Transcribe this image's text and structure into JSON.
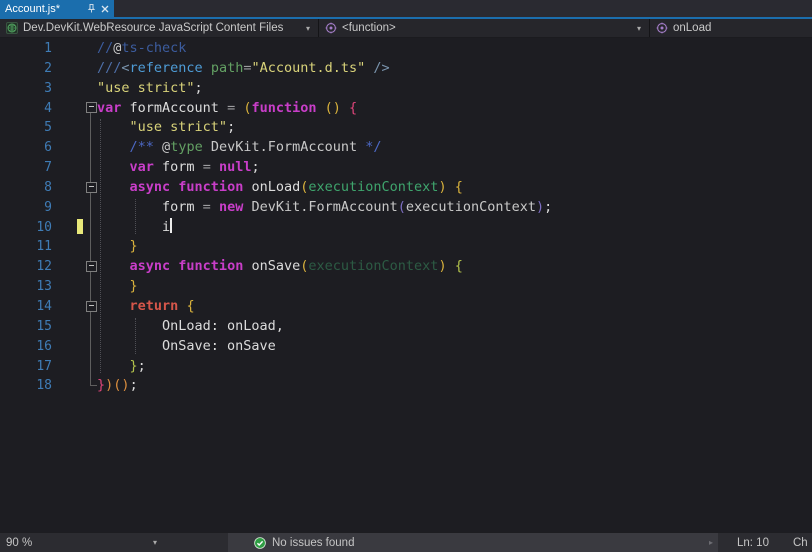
{
  "tab": {
    "title": "Account.js*",
    "pin_icon": "pin-icon",
    "close_icon": "close-icon"
  },
  "navbar": {
    "project": "Dev.DevKit.WebResource JavaScript Content Files",
    "scope": "<function>",
    "member": "onLoad",
    "caret_glyph": "▾"
  },
  "editor": {
    "lines": [
      {
        "n": 1,
        "segs": [
          [
            "//",
            "dim"
          ],
          [
            "@",
            "fg2"
          ],
          [
            "ts-check",
            "dim"
          ]
        ]
      },
      {
        "n": 2,
        "segs": [
          [
            "///",
            "dsl"
          ],
          [
            "<",
            "p2"
          ],
          [
            "reference",
            "blu"
          ],
          [
            " ",
            "fg"
          ],
          [
            "path",
            "grn"
          ],
          [
            "=",
            "op"
          ],
          [
            "\"Account.d.ts\"",
            "str"
          ],
          [
            " ",
            "fg"
          ],
          [
            "/>",
            "p2"
          ]
        ]
      },
      {
        "n": 3,
        "segs": [
          [
            "\"use strict\"",
            "str"
          ],
          [
            ";",
            "fg"
          ]
        ]
      },
      {
        "n": 4,
        "segs": [
          [
            "var",
            "kw"
          ],
          [
            " ",
            "fg"
          ],
          [
            "formAccount",
            "fg"
          ],
          [
            " = ",
            "op"
          ],
          [
            "(",
            "gold"
          ],
          [
            "function",
            "kw"
          ],
          [
            " ",
            "fg"
          ],
          [
            "()",
            "gold"
          ],
          [
            " ",
            "fg"
          ],
          [
            "{",
            "pink"
          ]
        ]
      },
      {
        "n": 5,
        "segs": [
          [
            "    ",
            "fg"
          ],
          [
            "\"use strict\"",
            "str"
          ],
          [
            ";",
            "fg"
          ]
        ]
      },
      {
        "n": 6,
        "segs": [
          [
            "    ",
            "fg"
          ],
          [
            "/**",
            "doc"
          ],
          [
            " ",
            "fg"
          ],
          [
            "@",
            "fg2"
          ],
          [
            "type",
            "grn"
          ],
          [
            " ",
            "fg"
          ],
          [
            "DevKit.FormAccount",
            "fg2"
          ],
          [
            " ",
            "fg"
          ],
          [
            "*/",
            "doc"
          ]
        ]
      },
      {
        "n": 7,
        "segs": [
          [
            "    ",
            "fg"
          ],
          [
            "var",
            "kw"
          ],
          [
            " ",
            "fg"
          ],
          [
            "form",
            "fg"
          ],
          [
            " = ",
            "op"
          ],
          [
            "null",
            "kw"
          ],
          [
            ";",
            "fg"
          ]
        ]
      },
      {
        "n": 8,
        "segs": [
          [
            "    ",
            "fg"
          ],
          [
            "async",
            "kw"
          ],
          [
            " ",
            "fg"
          ],
          [
            "function",
            "kw"
          ],
          [
            " ",
            "fg"
          ],
          [
            "onLoad",
            "fg"
          ],
          [
            "(",
            "gold"
          ],
          [
            "executionContext",
            "par"
          ],
          [
            ")",
            "gold"
          ],
          [
            " ",
            "fg"
          ],
          [
            "{",
            "gold"
          ]
        ]
      },
      {
        "n": 9,
        "segs": [
          [
            "        ",
            "fg"
          ],
          [
            "form",
            "fg"
          ],
          [
            " = ",
            "op"
          ],
          [
            "new",
            "kw"
          ],
          [
            " ",
            "fg"
          ],
          [
            "DevKit.FormAccount",
            "fg2"
          ],
          [
            "(",
            "pur"
          ],
          [
            "executionContext",
            "fg2"
          ],
          [
            ")",
            "pur"
          ],
          [
            ";",
            "fg"
          ]
        ]
      },
      {
        "n": 10,
        "segs": [
          [
            "        i",
            "fg"
          ]
        ],
        "caret": true
      },
      {
        "n": 11,
        "segs": [
          [
            "    ",
            "fg"
          ],
          [
            "}",
            "gold"
          ]
        ]
      },
      {
        "n": 12,
        "segs": [
          [
            "    ",
            "fg"
          ],
          [
            "async",
            "kw"
          ],
          [
            " ",
            "fg"
          ],
          [
            "function",
            "kw"
          ],
          [
            " ",
            "fg"
          ],
          [
            "onSave",
            "fg"
          ],
          [
            "(",
            "gold"
          ],
          [
            "executionContext",
            "pard"
          ],
          [
            ")",
            "gold"
          ],
          [
            " ",
            "fg"
          ],
          [
            "{",
            "grn2"
          ]
        ]
      },
      {
        "n": 13,
        "segs": [
          [
            "    ",
            "fg"
          ],
          [
            "}",
            "gold"
          ]
        ]
      },
      {
        "n": 14,
        "segs": [
          [
            "    ",
            "fg"
          ],
          [
            "return",
            "ret"
          ],
          [
            " ",
            "fg"
          ],
          [
            "{",
            "gold"
          ]
        ]
      },
      {
        "n": 15,
        "segs": [
          [
            "        OnLoad: onLoad,",
            "fg"
          ]
        ]
      },
      {
        "n": 16,
        "segs": [
          [
            "        OnSave: onSave",
            "fg"
          ]
        ]
      },
      {
        "n": 17,
        "segs": [
          [
            "    ",
            "fg"
          ],
          [
            "}",
            "grn2"
          ],
          [
            ";",
            "fg"
          ]
        ]
      },
      {
        "n": 18,
        "segs": [
          [
            "}",
            "pink"
          ],
          [
            ")",
            "org"
          ],
          [
            "(",
            "org"
          ],
          [
            ")",
            "org"
          ],
          [
            ";",
            "fg"
          ]
        ]
      }
    ],
    "fold_rows": [
      4,
      8,
      12,
      14
    ],
    "fold_line": {
      "from": 4,
      "to": 18
    },
    "change_bar_row": 10,
    "guides": [
      {
        "x": 3,
        "r1": 5,
        "r2": 17
      },
      {
        "x": 38,
        "r1": 9,
        "r2": 10
      },
      {
        "x": 38,
        "r1": 15,
        "r2": 16
      }
    ]
  },
  "statusbar": {
    "zoom": "90 %",
    "health": "No issues found",
    "line_indicator": "Ln: 10",
    "char_indicator": "Ch",
    "caret_glyph": "▾",
    "scroll_arrow_glyph": "▸"
  },
  "theme": {
    "accent": "#1b6ead",
    "edbg": "#1d1d22",
    "fg": "#dcdcdc",
    "fg2": "#c8c8c8",
    "op": "#9d9da0",
    "kw": "#c93ec9",
    "ret": "#d6564a",
    "str": "#d9d37a",
    "grn": "#63a063",
    "blu": "#4e9cd6",
    "doc": "#4c68c4",
    "dsl": "#4e6fa8",
    "dim": "#3c5c9e",
    "p2": "#7a94ad",
    "par": "#3fa56d",
    "gold": "#d9b23c",
    "pink": "#e0457b",
    "grn2": "#b2c24b",
    "org": "#dd8f3f",
    "pur": "#7e6fc4",
    "chg": "#e8e87a",
    "lnum": "#3f7cb6",
    "health_green": "#2f9e44"
  }
}
